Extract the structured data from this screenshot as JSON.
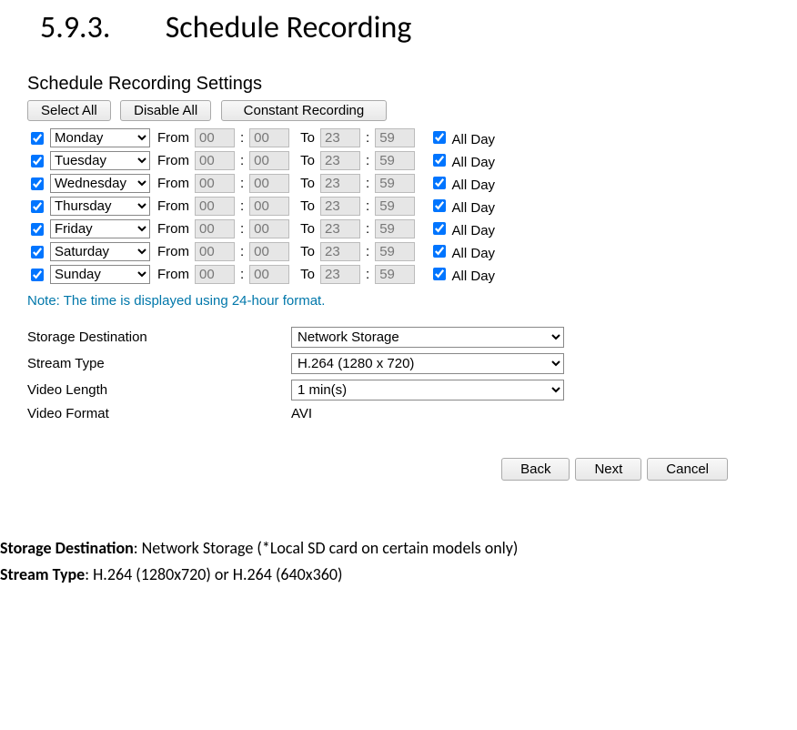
{
  "section_number": "5.9.3.",
  "section_title": "Schedule Recording",
  "settings_title": "Schedule Recording Settings",
  "buttons": {
    "select_all": "Select All",
    "disable_all": "Disable All",
    "constant": "Constant Recording"
  },
  "labels": {
    "from": "From",
    "to": "To",
    "all_day": "All Day"
  },
  "days": [
    {
      "name": "Monday",
      "checked": true,
      "from_h": "00",
      "from_m": "00",
      "to_h": "23",
      "to_m": "59",
      "allday": true
    },
    {
      "name": "Tuesday",
      "checked": true,
      "from_h": "00",
      "from_m": "00",
      "to_h": "23",
      "to_m": "59",
      "allday": true
    },
    {
      "name": "Wednesday",
      "checked": true,
      "from_h": "00",
      "from_m": "00",
      "to_h": "23",
      "to_m": "59",
      "allday": true
    },
    {
      "name": "Thursday",
      "checked": true,
      "from_h": "00",
      "from_m": "00",
      "to_h": "23",
      "to_m": "59",
      "allday": true
    },
    {
      "name": "Friday",
      "checked": true,
      "from_h": "00",
      "from_m": "00",
      "to_h": "23",
      "to_m": "59",
      "allday": true
    },
    {
      "name": "Saturday",
      "checked": true,
      "from_h": "00",
      "from_m": "00",
      "to_h": "23",
      "to_m": "59",
      "allday": true
    },
    {
      "name": "Sunday",
      "checked": true,
      "from_h": "00",
      "from_m": "00",
      "to_h": "23",
      "to_m": "59",
      "allday": true
    }
  ],
  "note": "Note: The time is displayed using 24-hour format.",
  "fields": {
    "storage_label": "Storage Destination",
    "storage_value": "Network Storage",
    "stream_label": "Stream Type",
    "stream_value": "H.264 (1280 x 720)",
    "vlength_label": "Video Length",
    "vlength_value": "1 min(s)",
    "vformat_label": "Video Format",
    "vformat_value": "AVI"
  },
  "nav": {
    "back": "Back",
    "next": "Next",
    "cancel": "Cancel"
  },
  "desc": {
    "storage_b": "Storage Destination",
    "storage_t": ": Network Storage (*Local SD card on certain models only)",
    "stream_b": "Stream Type",
    "stream_t": ": H.264 (1280x720) or H.264 (640x360)"
  }
}
